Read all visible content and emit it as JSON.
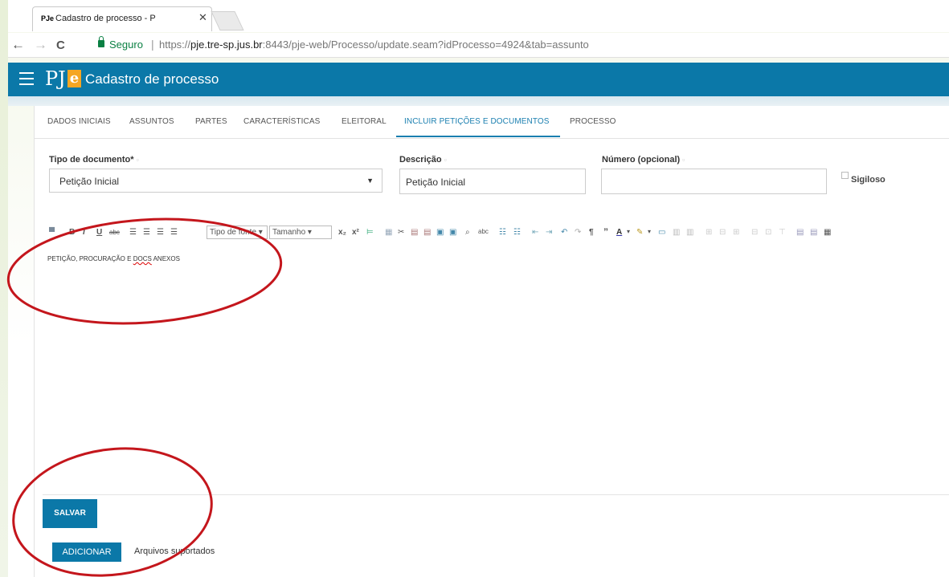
{
  "browser": {
    "tab_favicon": "PJe",
    "tab_title": "Cadastro de processo - P",
    "tab_close": "✕",
    "back": "←",
    "forward": "→",
    "reload": "C",
    "security_label": "Seguro",
    "separator": "|",
    "url_scheme": "https://",
    "url_host": "pje.tre-sp.jus.br",
    "url_rest": ":8443/pje-web/Processo/update.seam?idProcesso=4924&tab=assunto"
  },
  "header": {
    "logo_text": "PJ",
    "logo_accent": "e",
    "title": "Cadastro de processo",
    "bg_color": "#0b78a8"
  },
  "tabs": [
    {
      "label": "DADOS INICIAIS"
    },
    {
      "label": "ASSUNTOS"
    },
    {
      "label": "PARTES"
    },
    {
      "label": "CARACTERÍSTICAS"
    },
    {
      "label": "ELEITORAL"
    },
    {
      "label": "INCLUIR PETIÇÕES E DOCUMENTOS",
      "active": true
    },
    {
      "label": "PROCESSO"
    }
  ],
  "form": {
    "tipo_label": "Tipo de documento*",
    "tipo_value": "Petição Inicial",
    "descricao_label": "Descrição",
    "descricao_value": "Petição Inicial",
    "numero_label": "Número (opcional)",
    "numero_value": "",
    "sigiloso_label": "Sigiloso"
  },
  "toolbar": {
    "bold": "B",
    "italic": "I",
    "underline": "U",
    "strike": "abc",
    "font_select": "Tipo de fonte",
    "size_select": "Tamanho",
    "subscript": "x₂",
    "superscript": "x²",
    "find": "🔍",
    "paragraph": "¶",
    "quote": "”",
    "text_color": "A"
  },
  "editor": {
    "text_before": "PETIÇÃO, PROCURAÇÃO E ",
    "text_spell": "DOCS",
    "text_after": " ANEXOS"
  },
  "actions": {
    "save_label": "SALVAR",
    "add_label": "ADICIONAR",
    "supported_files": "Arquivos suportados"
  },
  "colors": {
    "accent": "#0b78a8",
    "active_tab": "#1a7fb0",
    "annotation": "#c4161c"
  }
}
